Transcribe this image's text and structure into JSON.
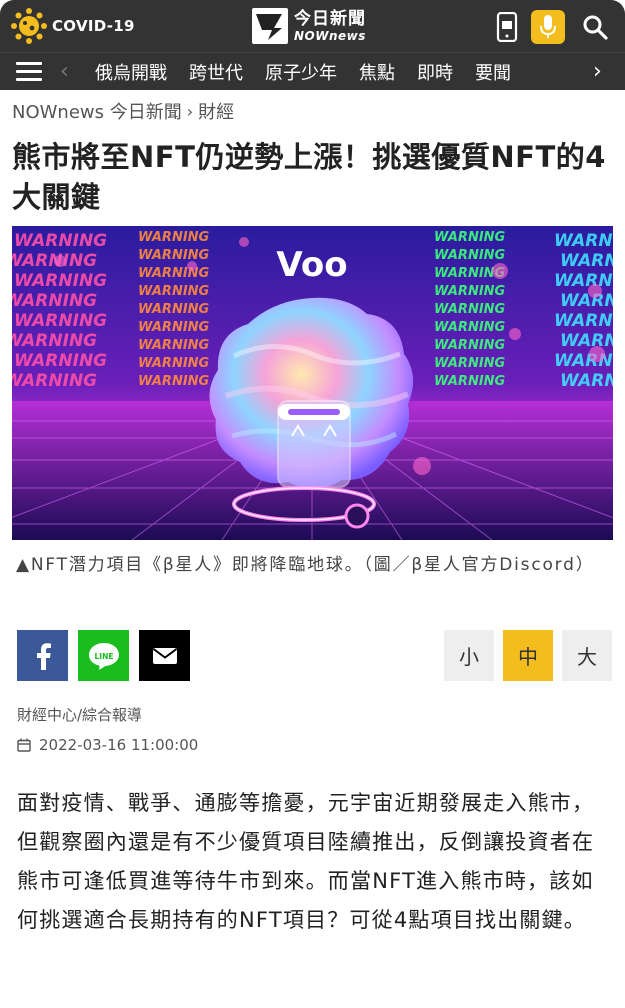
{
  "header": {
    "covid_label": "COVID-19",
    "logo_zh": "今日新聞",
    "logo_en": "NOWnews",
    "icons": [
      "virus-icon",
      "phone-app-icon",
      "microphone-icon",
      "search-icon"
    ],
    "accent_color": "#f2bd1d",
    "bar_color": "#333333"
  },
  "nav": {
    "items": [
      "俄烏開戰",
      "跨世代",
      "原子少年",
      "焦點",
      "即時",
      "要聞"
    ]
  },
  "breadcrumb": {
    "site": "NOWnews 今日新聞",
    "separator": "›",
    "section": "財經"
  },
  "article": {
    "title": "熊市將至NFT仍逆勢上漲！挑選優質NFT的4大關鍵",
    "hero_logo": "Voo",
    "hero_warning": "WARNING",
    "caption": "▲NFT潛力項目《β星人》即將降臨地球。（圖／β星人官方Discord）",
    "author": "財經中心/綜合報導",
    "date": "2022-03-16 11:00:00",
    "body": "面對疫情、戰爭、通膨等擔憂，元宇宙近期發展走入熊市，但觀察圈內還是有不少優質項目陸續推出，反倒讓投資者在熊市可逢低買進等待牛市到來。而當NFT進入熊市時，該如何挑選適合長期持有的NFT項目？可從4點項目找出關鍵。"
  },
  "share": {
    "facebook_color": "#3b5998",
    "line_color": "#19bd1e",
    "line_label": "LINE",
    "mail_color": "#000000"
  },
  "font_size": {
    "small": "小",
    "medium": "中",
    "large": "大",
    "selected": "中"
  }
}
